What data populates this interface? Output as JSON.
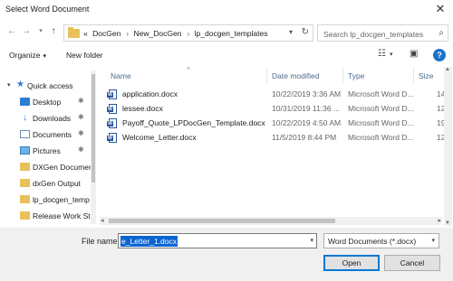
{
  "window": {
    "title": "Select Word Document",
    "close_glyph": "✕"
  },
  "nav": {
    "back_icon": "back-arrow-icon",
    "forward_icon": "forward-arrow-icon",
    "recent_icon": "chevron-down-icon",
    "up_icon": "up-arrow-icon",
    "breadcrumb_prefix": "«",
    "breadcrumbs": [
      "DocGen",
      "New_DocGen",
      "lp_docgen_templates"
    ],
    "search_placeholder": "Search lp_docgen_templates"
  },
  "toolbar": {
    "organize_label": "Organize",
    "new_folder_label": "New folder"
  },
  "sidebar": {
    "items": [
      {
        "label": "Quick access",
        "icon": "star-icon"
      },
      {
        "label": "Desktop",
        "icon": "desktop-icon",
        "pinned": true
      },
      {
        "label": "Downloads",
        "icon": "download-icon",
        "pinned": true
      },
      {
        "label": "Documents",
        "icon": "documents-icon",
        "pinned": true
      },
      {
        "label": "Pictures",
        "icon": "pictures-icon",
        "pinned": true
      },
      {
        "label": "DXGen Documer",
        "icon": "folder-icon"
      },
      {
        "label": "dxGen Output",
        "icon": "folder-icon"
      },
      {
        "label": "lp_docgen_temp",
        "icon": "folder-icon"
      },
      {
        "label": "Release Work Sta",
        "icon": "folder-icon"
      }
    ]
  },
  "columns": {
    "name": "Name",
    "date": "Date modified",
    "type": "Type",
    "size": "Size"
  },
  "files": [
    {
      "name": "application.docx",
      "date": "10/22/2019 3:36 AM",
      "type": "Microsoft Word D...",
      "size": "14"
    },
    {
      "name": "lessee.docx",
      "date": "10/31/2019 11:36 ...",
      "type": "Microsoft Word D...",
      "size": "12"
    },
    {
      "name": "Payoff_Quote_LPDocGen_Template.docx",
      "date": "10/22/2019 4:50 AM",
      "type": "Microsoft Word D...",
      "size": "19"
    },
    {
      "name": "Welcome_Letter.docx",
      "date": "11/5/2019 8:44 PM",
      "type": "Microsoft Word D...",
      "size": "12"
    }
  ],
  "footer": {
    "file_name_label": "File name:",
    "file_name_value": "e_Letter_1.docx",
    "file_type_value": "Word Documents (*.docx)",
    "open_label": "Open",
    "cancel_label": "Cancel"
  },
  "colors": {
    "accent": "#0078d7",
    "folder": "#e8c15a",
    "word": "#2b5797",
    "selection": "#0a64d2"
  }
}
